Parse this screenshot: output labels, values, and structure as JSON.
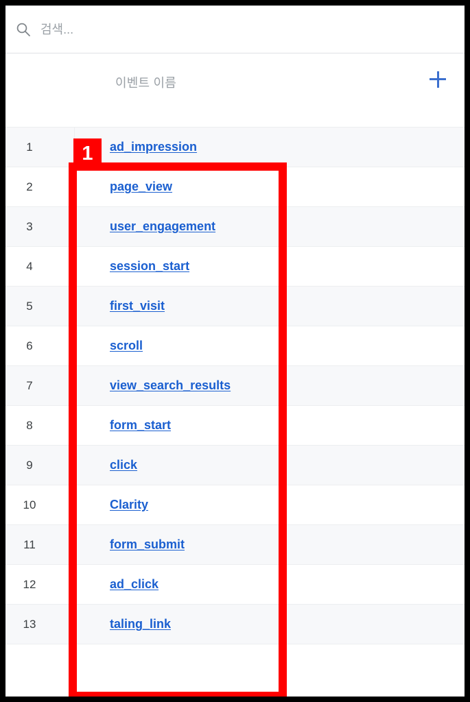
{
  "search": {
    "icon": "search-icon",
    "placeholder": "검색...",
    "value": ""
  },
  "table_header": {
    "event_name_label": "이벤트 이름",
    "add_button_icon": "plus-icon",
    "add_button_label": "+"
  },
  "colors": {
    "link": "#1a5fd0",
    "accent_plus": "#3b6fce",
    "annotation": "#ff0000",
    "row_alt_background": "#f7f8fa",
    "row_background": "#ffffff",
    "muted_text": "#9aa0a6",
    "frame": "#000000"
  },
  "annotation": {
    "badge_number": "1"
  },
  "rows": [
    {
      "index": "1",
      "event_name": "ad_impression"
    },
    {
      "index": "2",
      "event_name": "page_view"
    },
    {
      "index": "3",
      "event_name": "user_engagement"
    },
    {
      "index": "4",
      "event_name": "session_start"
    },
    {
      "index": "5",
      "event_name": "first_visit"
    },
    {
      "index": "6",
      "event_name": "scroll"
    },
    {
      "index": "7",
      "event_name": "view_search_results"
    },
    {
      "index": "8",
      "event_name": "form_start"
    },
    {
      "index": "9",
      "event_name": "click"
    },
    {
      "index": "10",
      "event_name": "Clarity"
    },
    {
      "index": "11",
      "event_name": "form_submit"
    },
    {
      "index": "12",
      "event_name": "ad_click"
    },
    {
      "index": "13",
      "event_name": "taling_link"
    }
  ]
}
